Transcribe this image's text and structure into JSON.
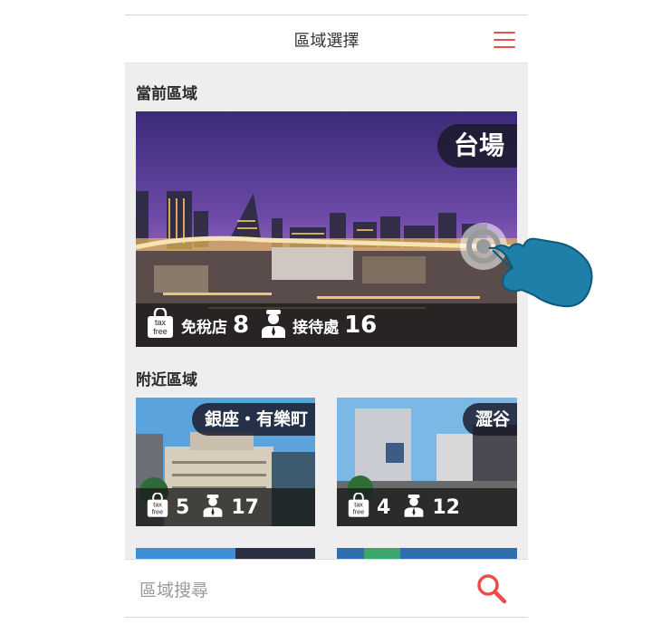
{
  "header": {
    "title": "區域選擇",
    "menu_icon": "hamburger-menu-icon",
    "accent": "#ef4b4b"
  },
  "current_section": {
    "title": "當前區域",
    "area": {
      "name": "台場",
      "tax_free_label": "免稅店",
      "tax_free_count": "8",
      "reception_label": "接待處",
      "reception_count": "16"
    }
  },
  "nearby_section": {
    "title": "附近區域",
    "areas": [
      {
        "name": "銀座・有樂町",
        "tax_free_count": "5",
        "reception_count": "17"
      },
      {
        "name": "澀谷",
        "tax_free_count": "4",
        "reception_count": "12"
      }
    ]
  },
  "icons": {
    "tax_free_top": "tax",
    "tax_free_bottom": "free",
    "reception": "reception-staff-icon",
    "search": "search-icon"
  },
  "search": {
    "placeholder": "區域搜尋"
  }
}
